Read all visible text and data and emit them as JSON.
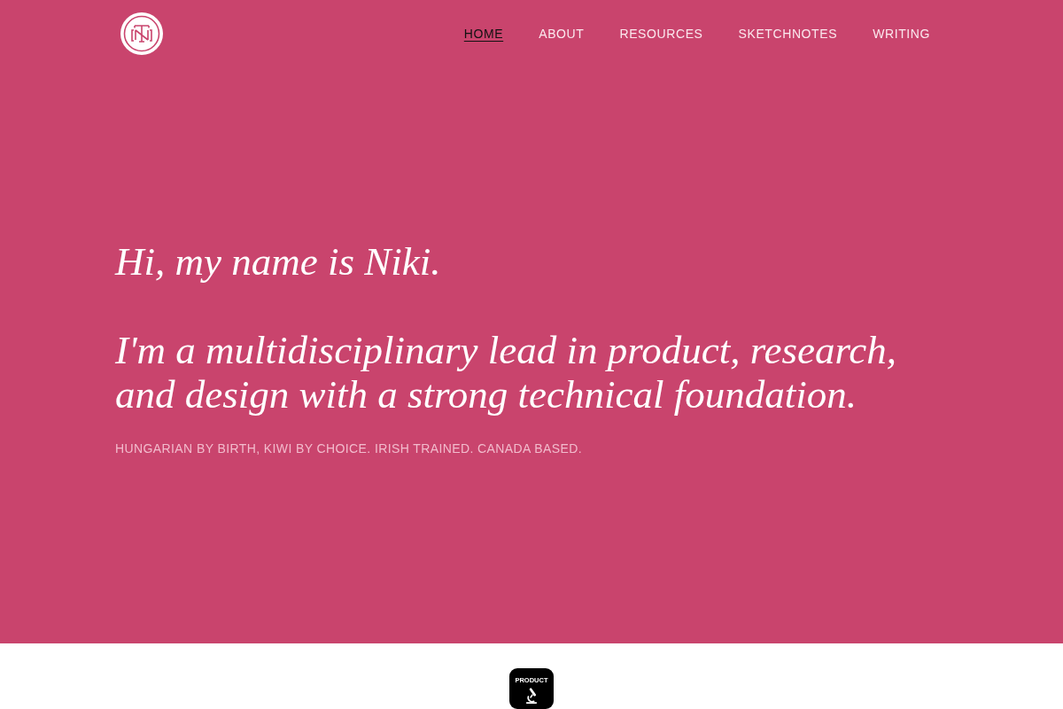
{
  "header": {
    "nav": [
      {
        "label": "HOME",
        "selected": true
      },
      {
        "label": "ABOUT",
        "selected": false
      },
      {
        "label": "RESOURCES",
        "selected": false
      },
      {
        "label": "SKETCHNOTES",
        "selected": false
      },
      {
        "label": "WRITING",
        "selected": false
      }
    ]
  },
  "hero": {
    "greeting": "Hi, my name is Niki.",
    "intro": "I'm a multidisciplinary lead in product, research, and design with a strong technical foundation.",
    "tagline": "HUNGARIAN BY BIRTH, KIWI BY CHOICE. IRISH TRAINED. CANADA BASED."
  },
  "featured": {
    "badge_text": "PRODUCT"
  }
}
